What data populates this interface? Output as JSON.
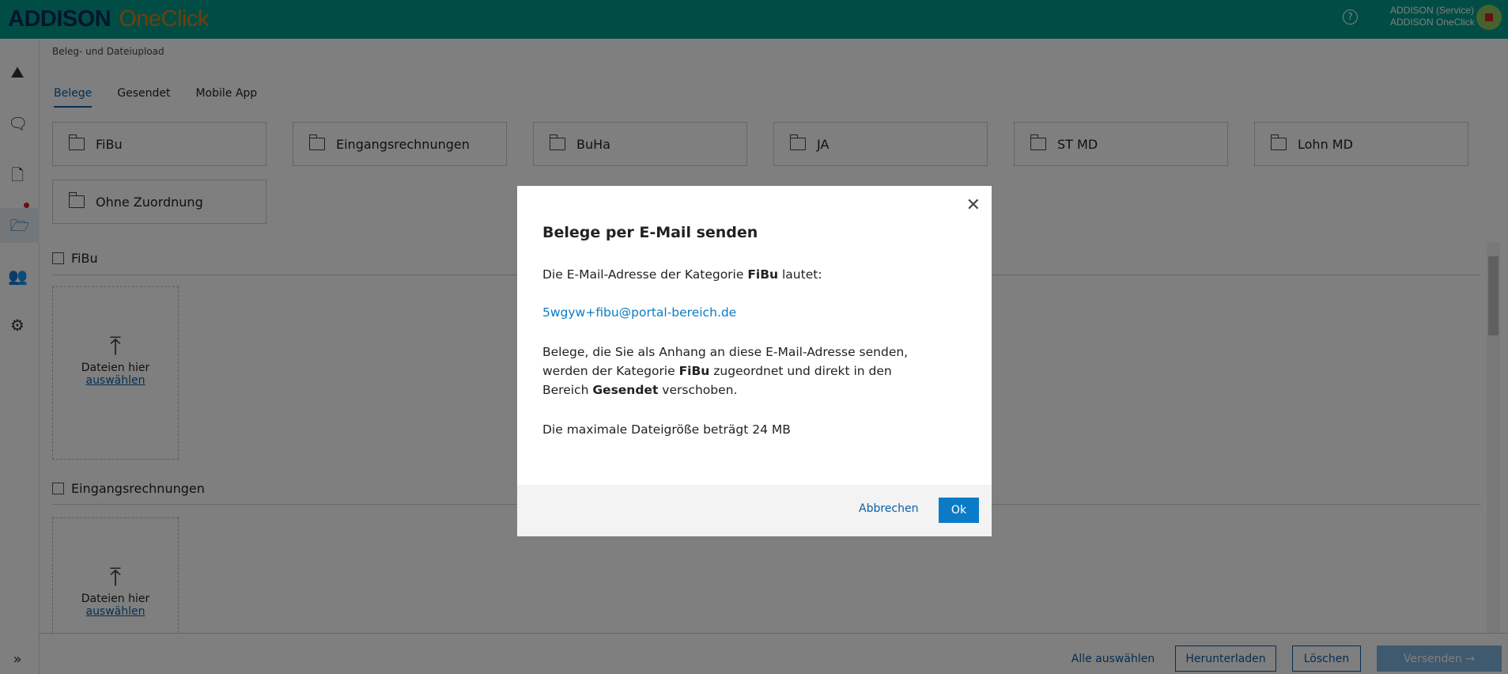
{
  "header": {
    "logo_brand": "ADDISON",
    "logo_product": "OneClick",
    "help": "?",
    "user_line1": "ADDISON (Service)",
    "user_line2": "ADDISON OneClick"
  },
  "breadcrumb": "Beleg- und Dateiupload",
  "tabs": [
    "Belege",
    "Gesendet",
    "Mobile App"
  ],
  "folders": [
    "FiBu",
    "Eingangsrechnungen",
    "BuHa",
    "JA",
    "ST MD",
    "Lohn MD",
    "Ohne Zuordnung"
  ],
  "sections": [
    {
      "label": "FiBu",
      "drop_text": "Dateien hier",
      "drop_link": "auswählen"
    },
    {
      "label": "Eingangsrechnungen",
      "drop_text": "Dateien hier",
      "drop_link": "auswählen"
    }
  ],
  "footer": {
    "select_all": "Alle auswählen",
    "download": "Herunterladen",
    "delete": "Löschen",
    "send": "Versenden →"
  },
  "modal": {
    "title": "Belege per E-Mail senden",
    "p1_pre": "Die E-Mail-Adresse der Kategorie ",
    "p1_bold": "FiBu",
    "p1_post": " lautet:",
    "email": "5wgyw+fibu@portal-bereich.de",
    "p2_a": "Belege, die Sie als Anhang an diese E-Mail-Adresse senden, werden der Kategorie ",
    "p2_bold1": "FiBu",
    "p2_b": " zugeordnet und direkt in den",
    "p2_c": "Bereich ",
    "p2_bold2": "Gesendet",
    "p2_d": " verschoben.",
    "p3": "Die maximale Dateigröße beträgt 24 MB",
    "cancel": "Abbrechen",
    "ok": "Ok"
  }
}
